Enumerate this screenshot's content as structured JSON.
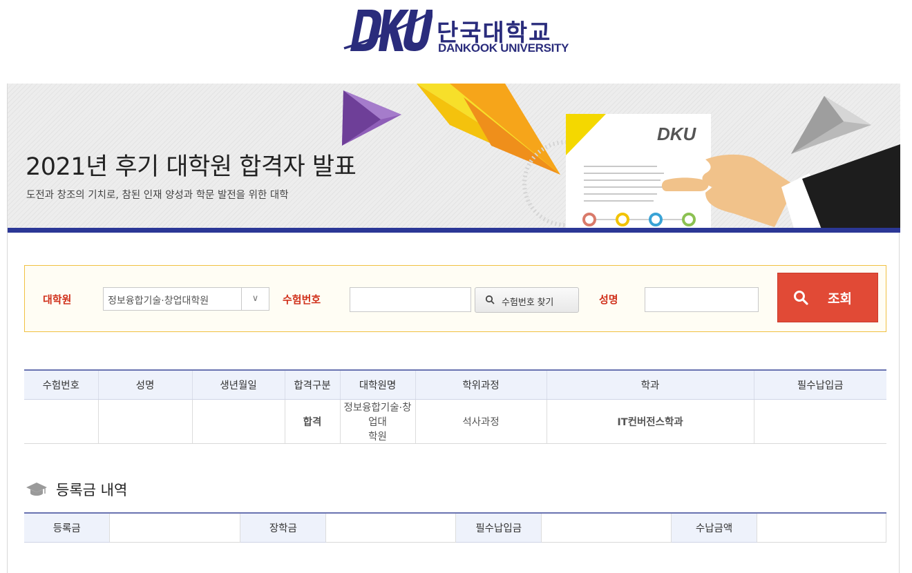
{
  "header": {
    "logo_mark": "DKU",
    "logo_korean": "단국대학교",
    "logo_english": "DANKOOK UNIVERSITY"
  },
  "banner": {
    "title": "2021년 후기 대학원 합격자 발표",
    "subtitle": "도전과 창조의 기치로, 참된 인재 양성과 학문 발전을 위한 대학",
    "card_logo": "DKU"
  },
  "search": {
    "graduate_school_label": "대학원",
    "graduate_school_value": "정보융합기술·창업대학원",
    "exam_number_label": "수험번호",
    "exam_number_value": "",
    "find_button_label": "수험번호 찾기",
    "name_label": "성명",
    "name_value": "",
    "submit_label": "조회"
  },
  "result_table": {
    "headers": [
      "수험번호",
      "성명",
      "생년월일",
      "합격구분",
      "대학원명",
      "학위과정",
      "학과",
      "필수납입금"
    ],
    "row": {
      "exam_number": "",
      "name": "",
      "birth_date": "",
      "status": "합격",
      "school_line1": "정보융합기술·창업대",
      "school_line2": "학원",
      "degree": "석사과정",
      "department": "IT컨버전스학과",
      "required_payment": ""
    }
  },
  "tuition": {
    "section_title": "등록금 내역",
    "labels": [
      "등록금",
      "장학금",
      "필수납입금",
      "수납금액"
    ],
    "values": [
      "",
      "",
      "",
      ""
    ]
  },
  "colors": {
    "brand_navy": "#2a2c7c",
    "banner_rule": "#2b3796",
    "accent_red": "#e14a36",
    "label_red": "#d0301a",
    "search_border": "#f0c040"
  }
}
